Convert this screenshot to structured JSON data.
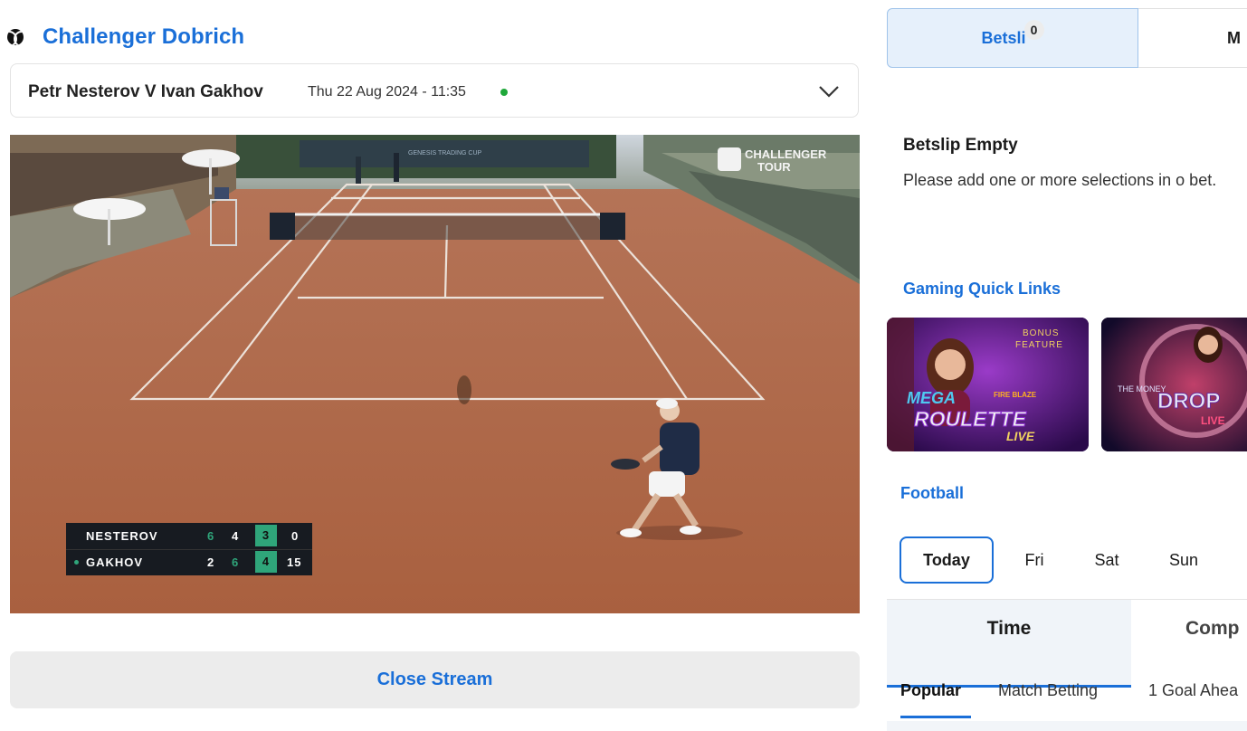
{
  "competition": {
    "name": "Challenger Dobrich",
    "icon": "tennis-ball-icon"
  },
  "match": {
    "name": "Petr Nesterov V Ivan Gakhov",
    "datetime": "Thu 22 Aug 2024 - 11:35",
    "live_color": "#1fa83a"
  },
  "stream": {
    "overlay_brand": "CHALLENGER TOUR",
    "banner_text": "GENESIS TRADING CUP",
    "scoreboard": [
      {
        "player": "NESTEROV",
        "serving": false,
        "set1": "6",
        "set2": "4",
        "set3": "3",
        "points": "0"
      },
      {
        "player": "GAKHOV",
        "serving": true,
        "set1": "2",
        "set2": "6",
        "set3": "4",
        "points": "15"
      }
    ],
    "close_label": "Close Stream"
  },
  "betslip": {
    "tab_label": "Betsli",
    "count": "0",
    "mybets_label": "M",
    "empty_title": "Betslip Empty",
    "empty_text": "Please add one or more selections in o bet."
  },
  "gaming": {
    "title": "Gaming Quick Links",
    "tiles": [
      {
        "line1": "MEGA",
        "line1b": "FIRE BLAZE",
        "line2": "ROULETTE",
        "line3": "LIVE",
        "badge1": "BONUS",
        "badge2": "FEATURE"
      },
      {
        "line1": "THE MONEY",
        "line2": "DROP",
        "line3": "LIVE"
      }
    ]
  },
  "football": {
    "title": "Football",
    "days": [
      "Today",
      "Fri",
      "Sat",
      "Sun"
    ],
    "tabs": {
      "time": "Time",
      "comp": "Comp"
    },
    "markets": [
      "Popular",
      "Match Betting",
      "1 Goal Ahea"
    ]
  },
  "colors": {
    "accent": "#1a6fd8",
    "clay": "#b06a4b",
    "scoreboard_bg": "#171b21",
    "score_highlight": "#2fa57a"
  }
}
